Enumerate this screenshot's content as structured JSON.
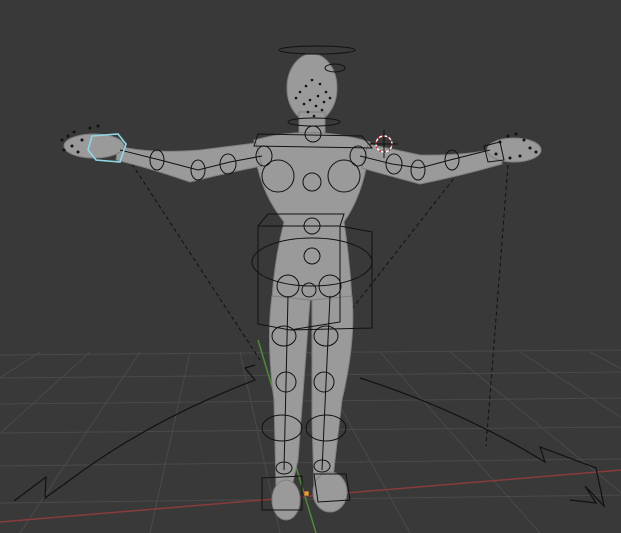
{
  "viewport": {
    "background_color": "#393939",
    "grid_color": "#4a4a4a",
    "x_axis_color": "#8a3a3a",
    "y_axis_color": "#4f8a3a"
  },
  "rig": {
    "mesh_color": "#9a9a9a",
    "bone_line_color": "#111111",
    "selected_hand_control_color": "#8fd9e6",
    "origin_marker_color": "#e89b3b"
  },
  "overlays": {
    "icons": [
      "3d-cursor-icon"
    ]
  }
}
